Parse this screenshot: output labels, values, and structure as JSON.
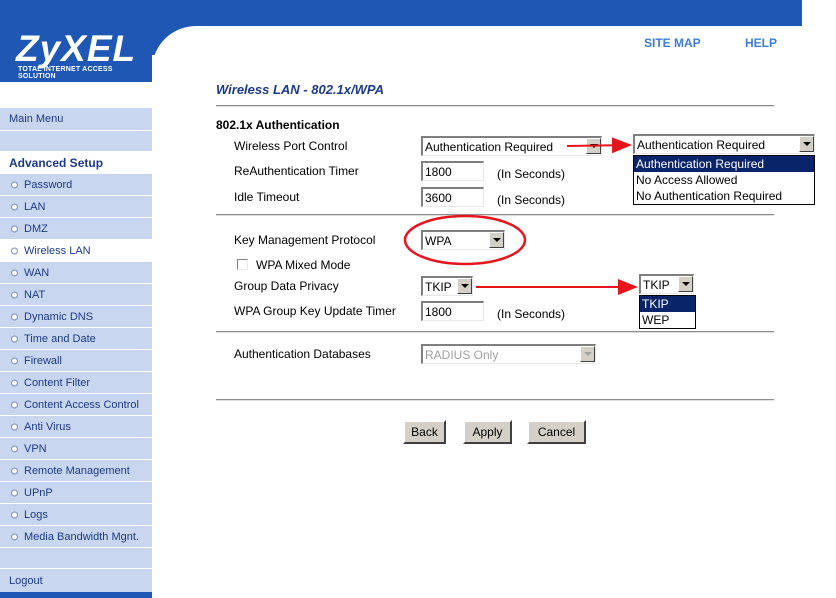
{
  "brand": {
    "logo": "ZyXEL",
    "tagline": "Total Internet Access Solution"
  },
  "top_links": {
    "site_map": "SITE MAP",
    "help": "HELP"
  },
  "sidebar": {
    "main_menu": "Main Menu",
    "advanced_setup": "Advanced Setup",
    "items": [
      {
        "label": "Password"
      },
      {
        "label": "LAN"
      },
      {
        "label": "DMZ"
      },
      {
        "label": "Wireless LAN"
      },
      {
        "label": "WAN"
      },
      {
        "label": "NAT"
      },
      {
        "label": "Dynamic DNS"
      },
      {
        "label": "Time and Date"
      },
      {
        "label": "Firewall"
      },
      {
        "label": "Content Filter"
      },
      {
        "label": "Content Access Control"
      },
      {
        "label": "Anti Virus"
      },
      {
        "label": "VPN"
      },
      {
        "label": "Remote Management"
      },
      {
        "label": "UPnP"
      },
      {
        "label": "Logs"
      },
      {
        "label": "Media Bandwidth Mgnt."
      }
    ],
    "logout": "Logout"
  },
  "main": {
    "page_title": "Wireless LAN - 802.1x/WPA",
    "section_title": "802.1x Authentication",
    "wireless_port_control": {
      "label": "Wireless Port Control",
      "value": "Authentication Required",
      "callout_value": "Authentication Required",
      "options": [
        "Authentication Required",
        "No Access Allowed",
        "No Authentication Required"
      ]
    },
    "reauth_timer": {
      "label": "ReAuthentication Timer",
      "value": "1800",
      "unit": "(In Seconds)"
    },
    "idle_timeout": {
      "label": "Idle Timeout",
      "value": "3600",
      "unit": "(In Seconds)"
    },
    "key_mgmt": {
      "label": "Key Management Protocol",
      "value": "WPA"
    },
    "wpa_mixed_mode": {
      "label": "WPA Mixed Mode",
      "checked": false
    },
    "group_data_privacy": {
      "label": "Group Data Privacy",
      "value": "TKIP",
      "callout_value": "TKIP",
      "options": [
        "TKIP",
        "WEP"
      ]
    },
    "group_key_timer": {
      "label": "WPA Group Key Update Timer",
      "value": "1800",
      "unit": "(In Seconds)"
    },
    "auth_databases": {
      "label": "Authentication Databases",
      "value": "RADIUS Only"
    }
  },
  "buttons": {
    "back": "Back",
    "apply": "Apply",
    "cancel": "Cancel"
  },
  "colors": {
    "banner": "#1f57b4",
    "sidebar": "#c9d6ef",
    "annotation": "#e8141b",
    "selection": "#0a246a"
  }
}
